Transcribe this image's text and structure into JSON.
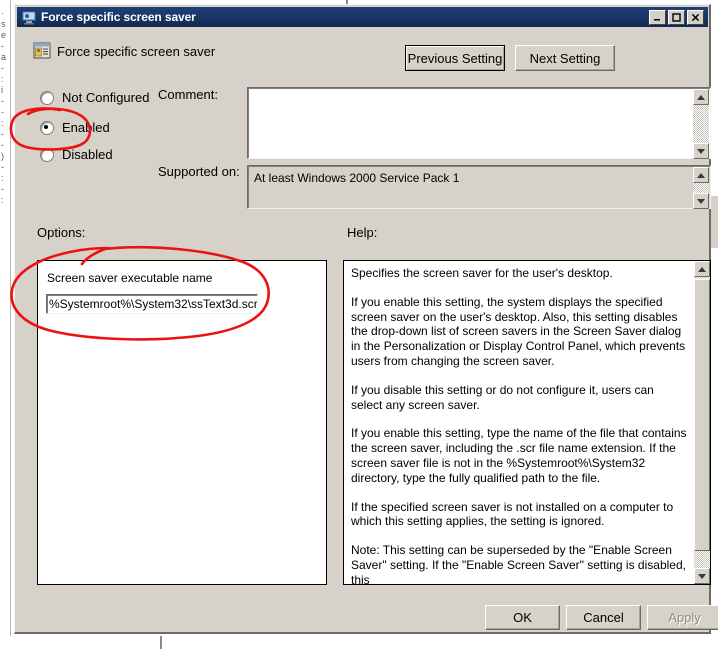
{
  "window": {
    "title": "Force specific screen saver",
    "title_icon": "screen-saver-policy-icon",
    "minimize_glyph": "_",
    "maximize_glyph": "□",
    "close_glyph": "✕",
    "titlebar_color": "#173461"
  },
  "header": {
    "setting_name": "Force specific screen saver",
    "setting_icon": "policy-setting-icon",
    "previous_button": "Previous Setting",
    "next_button": "Next Setting"
  },
  "state": {
    "not_configured_label": "Not Configured",
    "enabled_label": "Enabled",
    "disabled_label": "Disabled",
    "selected": "Enabled"
  },
  "comment": {
    "label": "Comment:",
    "value": "",
    "placeholder": ""
  },
  "supported": {
    "label": "Supported on:",
    "value": "At least Windows 2000 Service Pack 1"
  },
  "options": {
    "label": "Options:",
    "field_label": "Screen saver executable name",
    "field_value": "%Systemroot%\\System32\\ssText3d.scr"
  },
  "help": {
    "label": "Help:",
    "paragraphs": [
      "Specifies the screen saver for the user's desktop.",
      "If you enable this setting, the system displays the specified screen saver on the user's desktop. Also, this setting disables the drop-down list of screen savers in the Screen Saver dialog in the Personalization or Display Control Panel, which prevents users from changing the screen saver.",
      "If you disable this setting or do not configure it, users can select any screen saver.",
      "If you enable this setting, type the name of the file that contains the screen saver, including the .scr file name extension. If the screen saver file is not in the %Systemroot%\\System32 directory, type the fully qualified path to the file.",
      "If the specified screen saver is not installed on a computer to which this setting applies, the setting is ignored.",
      "Note: This setting can be superseded by the \"Enable Screen Saver\" setting.  If the \"Enable Screen Saver\" setting is disabled, this"
    ]
  },
  "footer": {
    "ok_label": "OK",
    "cancel_label": "Cancel",
    "apply_label": "Apply",
    "apply_disabled": true
  },
  "annotations": {
    "color": "#ee1111",
    "ellipse_enabled": "red-ellipse-around-enabled-radio",
    "ellipse_options": "red-ellipse-around-screen-saver-field"
  }
}
